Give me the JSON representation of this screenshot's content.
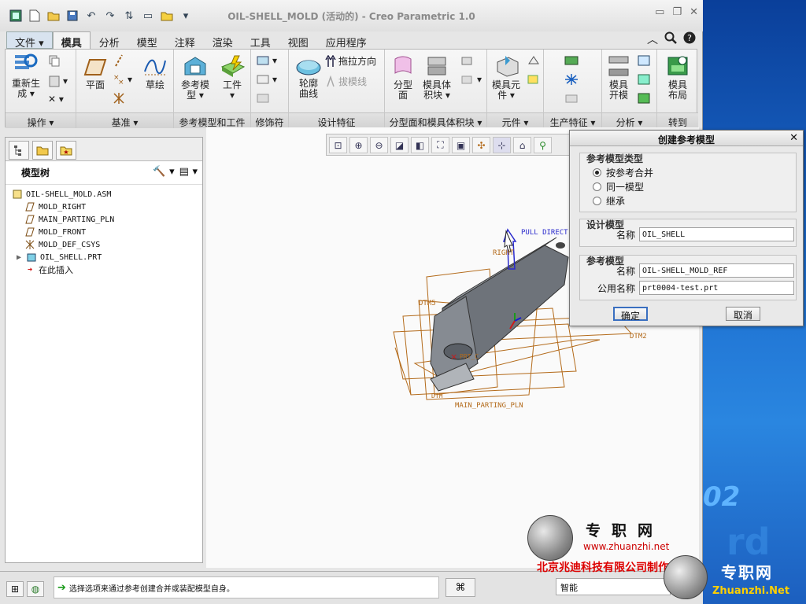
{
  "window": {
    "title": "OIL-SHELL_MOLD (活动的) - Creo Parametric 1.0"
  },
  "tabs": [
    {
      "label": "文件",
      "state": "file"
    },
    {
      "label": "模具",
      "state": "active"
    },
    {
      "label": "分析"
    },
    {
      "label": "模型"
    },
    {
      "label": "注释"
    },
    {
      "label": "渲染"
    },
    {
      "label": "工具"
    },
    {
      "label": "视图"
    },
    {
      "label": "应用程序"
    }
  ],
  "ribbon": {
    "groups": {
      "operations": "操作",
      "datum": "基准",
      "ref_model_workpiece": "参考模型和工件",
      "modifiers": "修饰符",
      "design_features": "设计特征",
      "parting": "分型面和模具体积块",
      "component": "元件",
      "production": "生产特征",
      "analysis": "分析",
      "goto": "转到"
    },
    "buttons": {
      "regenerate_l1": "重新生",
      "regenerate_l2": "成",
      "plane": "平面",
      "sketch": "草绘",
      "ref_model_l1": "参考模",
      "ref_model_l2": "型",
      "workpiece": "工件",
      "contour_curve_l1": "轮廓",
      "contour_curve_l2": "曲线",
      "pull_direction": "拖拉方向",
      "draft_line": "拔模线",
      "parting_surface_l1": "分型",
      "parting_surface_l2": "面",
      "mold_volume_l1": "模具体",
      "mold_volume_l2": "积块",
      "mold_component_l1": "模具元",
      "mold_component_l2": "件",
      "mold_open_l1": "模具",
      "mold_open_l2": "开模",
      "mold_layout_l1": "模具",
      "mold_layout_l2": "布局"
    }
  },
  "model_tree": {
    "title": "模型树",
    "nodes": [
      {
        "label": "OIL-SHELL_MOLD.ASM",
        "icon": "assembly-icon"
      },
      {
        "label": "MOLD_RIGHT",
        "icon": "datum-plane-icon"
      },
      {
        "label": "MAIN_PARTING_PLN",
        "icon": "datum-plane-icon"
      },
      {
        "label": "MOLD_FRONT",
        "icon": "datum-plane-icon"
      },
      {
        "label": "MOLD_DEF_CSYS",
        "icon": "csys-icon"
      },
      {
        "label": "OIL_SHELL.PRT",
        "icon": "part-icon"
      },
      {
        "label": "在此插入",
        "icon": "insert-here-arrow-icon"
      }
    ]
  },
  "graphics": {
    "labels": {
      "pull_direction": "PULL DIRECT",
      "right": "RIGHT",
      "dtm5": "DTM5",
      "dtm2": "DTM2",
      "main_parting": "MAIN_PARTING_PLN",
      "prt_csys": "PRT_C",
      "dtm": "DTM"
    }
  },
  "dialog": {
    "title": "创建参考模型",
    "ref_type": {
      "header": "参考模型类型",
      "options": [
        "按参考合并",
        "同一模型",
        "继承"
      ],
      "selected": 0
    },
    "design_model": {
      "header": "设计模型",
      "name_label": "名称",
      "name_value": "OIL_SHELL"
    },
    "ref_model": {
      "header": "参考模型",
      "name_label": "名称",
      "name_value": "OIL-SHELL_MOLD_REF",
      "common_name_label": "公用名称",
      "common_name_value": "prt0004-test.prt"
    },
    "ok_label": "确定",
    "cancel_label": "取消"
  },
  "status": {
    "message": "选择选项来通过参考创建合并或装配模型自身。",
    "filter_value": "智能"
  },
  "watermark": {
    "brand": "专职网",
    "url": "www.zhuanzhi.net",
    "company": "北京兆迪科技有限公司制作",
    "brand2": "专职网",
    "url2": "Zhuanzhi.Net",
    "desktop_num": "02",
    "desktop_rd": "rd"
  },
  "colors": {
    "accent_tab": "#d8e3ef",
    "datum_orange": "#b36a1a",
    "part_gray": "#6e737a",
    "pull_blue": "#2a2acc"
  }
}
